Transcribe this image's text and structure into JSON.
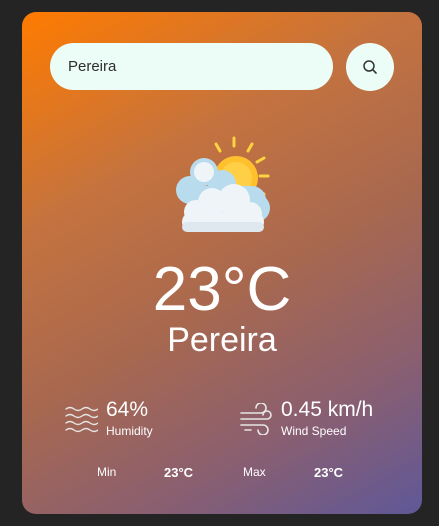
{
  "search": {
    "value": "Pereira",
    "button_icon": "search-icon"
  },
  "weather": {
    "icon": "partly-cloudy-sun-icon",
    "temperature": "23°C",
    "city": "Pereira"
  },
  "humidity": {
    "icon": "humidity-waves-icon",
    "value": "64%",
    "label": "Humidity"
  },
  "wind": {
    "icon": "wind-icon",
    "value": "0.45 km/h",
    "label": "Wind Speed"
  },
  "range": {
    "min_label": "Min",
    "min_value": "23°C",
    "max_label": "Max",
    "max_value": "23°C"
  },
  "colors": {
    "card_gradient_start": "#ff7b00",
    "card_gradient_end": "#5f5898",
    "input_background": "#ecfdf7",
    "page_background": "#242424"
  }
}
